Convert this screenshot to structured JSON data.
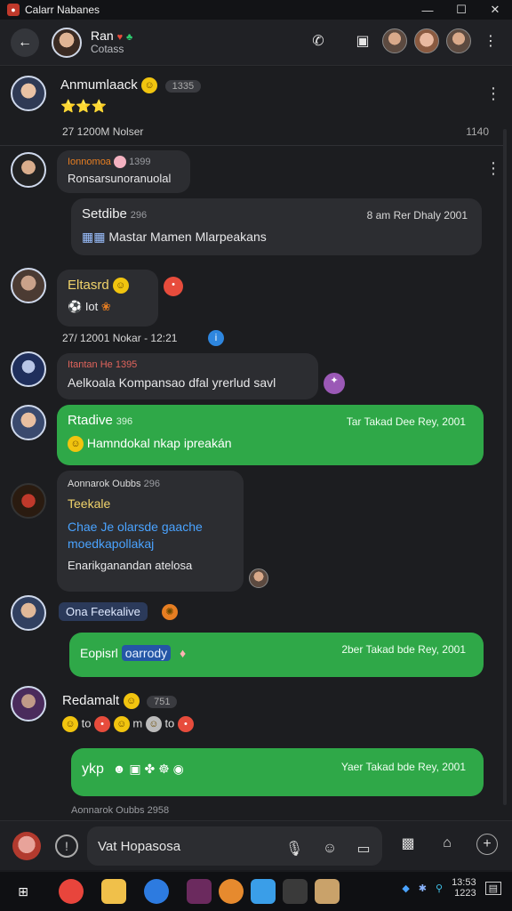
{
  "window": {
    "title": "Calarr Nabanes",
    "controls": [
      "—",
      "☐",
      "✕"
    ]
  },
  "header": {
    "contact_name": "Ran",
    "contact_status": "Cotass",
    "icons": [
      "phone-icon",
      "video-icon",
      "more-icon"
    ]
  },
  "messages": [
    {
      "sender": "Anmumlaack",
      "pill": "1335",
      "reactions": "⭐⭐⭐",
      "time_note": "27 1200M Nolser",
      "right_time": "1140"
    },
    {
      "sender": "Ionnomoa",
      "pill": "1399",
      "text": "Ronsarsunoranuolal"
    },
    {
      "sender": "Setdibe",
      "pill": "296",
      "text": "Mastar  Mamen Mlarpeakans",
      "right": "8 am Rer Dhaly 2001"
    },
    {
      "sender": "Eltasrd",
      "text": "Iot",
      "time_note": "27/ 12001 Nokar - 12:21"
    },
    {
      "sender": "Itantan He",
      "pill": "1395",
      "text": "Aelkoala Kompansao dfal  yrerlud savl"
    },
    {
      "sender": "Rtadive",
      "pill": "396",
      "text": "Hamndokal nkap ipreakán",
      "right": "Tar Takad Dee Rey, 2001"
    },
    {
      "sender": "Aonnarok Oubbs",
      "pill": "296",
      "sub": "Teekale",
      "link": "Chae Je olarsde gaache moedkapollakaj",
      "text": "Enarikganandan atelosa"
    },
    {
      "tag": "Ona Feekalive"
    },
    {
      "text": "Eopisrl",
      "tag": "oarrody",
      "right": "2ber Takad bde Rey, 2001"
    },
    {
      "sender": "Redamalt",
      "pill": "751",
      "reactions": [
        "to",
        "m",
        "to"
      ]
    },
    {
      "text": "ykp",
      "right": "Yaer Takad bde Rey, 2001"
    },
    {
      "footer": "Aonnarok Oubbs 2958"
    }
  ],
  "composer": {
    "placeholder": "Vat Hopasosa"
  },
  "taskbar": {
    "clock": "13:53",
    "date": "1223"
  }
}
